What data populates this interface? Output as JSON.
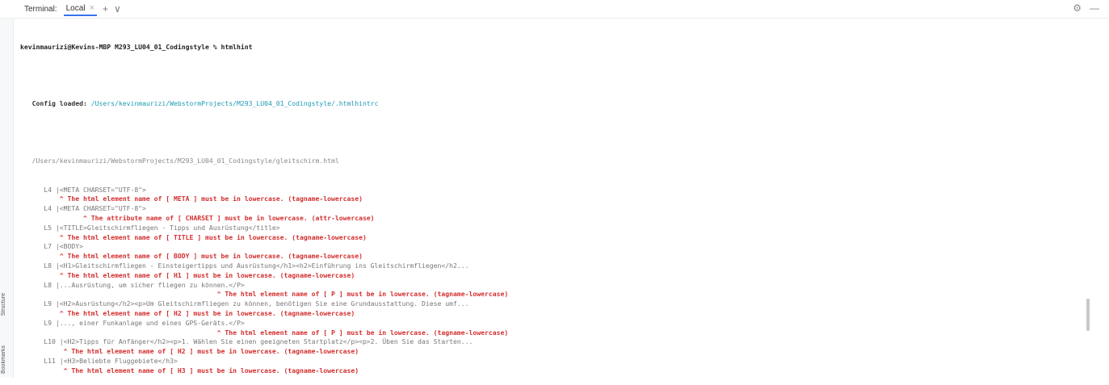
{
  "tabbar": {
    "title": "Terminal:",
    "tab_label": "Local",
    "close_glyph": "×",
    "add_glyph": "+",
    "dropdown_glyph": "∨",
    "settings_glyph": "⚙",
    "minimize_glyph": "—"
  },
  "sidebar": {
    "structure_label": "Structure",
    "bookmarks_label": "Bookmarks"
  },
  "terminal": {
    "prompt": "kevinmaurizi@Kevins-MBP M293_LU04_01_Codingstyle % htmlhint",
    "config_label": "   Config loaded: ",
    "config_path": "/Users/kevinmaurizi/WebstormProjects/M293_LU04_01_Codingstyle/.htmlhintrc",
    "file_path": "   /Users/kevinmaurizi/WebstormProjects/M293_LU04_01_Codingstyle/gleitschirm.html",
    "lines": [
      {
        "type": "code",
        "text": "      L4 |<META CHARSET=\"UTF-8\">"
      },
      {
        "type": "err",
        "text": "          ^ The html element name of [ META ] must be in lowercase. (tagname-lowercase)"
      },
      {
        "type": "code",
        "text": "      L4 |<META CHARSET=\"UTF-8\">"
      },
      {
        "type": "err",
        "text": "                ^ The attribute name of [ CHARSET ] must be in lowercase. (attr-lowercase)"
      },
      {
        "type": "code",
        "text": "      L5 |<TITLE>Gleitschirmfliegen - Tipps und Ausrüstung</title>"
      },
      {
        "type": "err",
        "text": "          ^ The html element name of [ TITLE ] must be in lowercase. (tagname-lowercase)"
      },
      {
        "type": "code",
        "text": "      L7 |<BODY>"
      },
      {
        "type": "err",
        "text": "          ^ The html element name of [ BODY ] must be in lowercase. (tagname-lowercase)"
      },
      {
        "type": "code",
        "text": "      L8 |<H1>Gleitschirmfliegen - Einsteigertipps und Ausrüstung</h1><h2>Einführung ins Gleitschirmfliegen</h2..."
      },
      {
        "type": "err",
        "text": "          ^ The html element name of [ H1 ] must be in lowercase. (tagname-lowercase)"
      },
      {
        "type": "code",
        "text": "      L8 |...Ausrüstung, um sicher fliegen zu können.</P>"
      },
      {
        "type": "err",
        "text": "                                                  ^ The html element name of [ P ] must be in lowercase. (tagname-lowercase)"
      },
      {
        "type": "code",
        "text": "      L9 |<H2>Ausrüstung</h2><p>Um Gleitschirmfliegen zu können, benötigen Sie eine Grundausstattung. Diese umf..."
      },
      {
        "type": "err",
        "text": "          ^ The html element name of [ H2 ] must be in lowercase. (tagname-lowercase)"
      },
      {
        "type": "code",
        "text": "      L9 |..., einer Funkanlage und eines GPS-Geräts.</P>"
      },
      {
        "type": "err",
        "text": "                                                  ^ The html element name of [ P ] must be in lowercase. (tagname-lowercase)"
      },
      {
        "type": "code",
        "text": "      L10 |<H2>Tipps für Anfänger</h2><p>1. Wählen Sie einen geeigneten Startplatz</p><p>2. Üben Sie das Starten..."
      },
      {
        "type": "err",
        "text": "           ^ The html element name of [ H2 ] must be in lowercase. (tagname-lowercase)"
      },
      {
        "type": "code",
        "text": "      L11 |<H3>Beliebte Fluggebiete</h3>"
      },
      {
        "type": "err",
        "text": "           ^ The html element name of [ H3 ] must be in lowercase. (tagname-lowercase)"
      }
    ]
  }
}
